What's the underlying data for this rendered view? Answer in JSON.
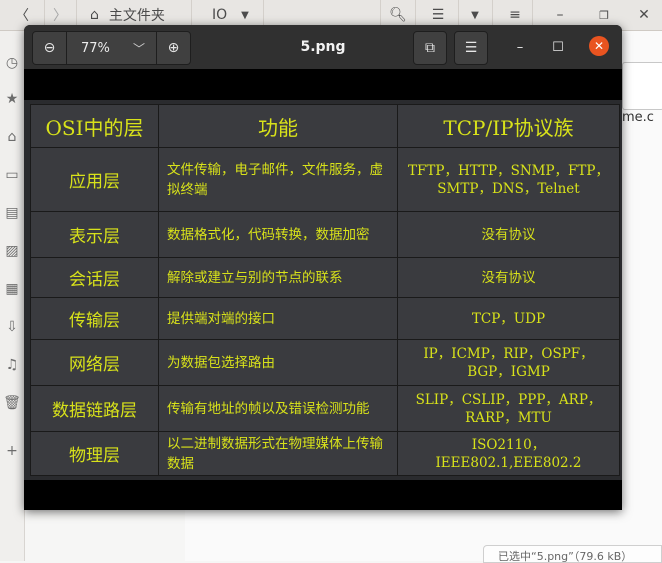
{
  "file_manager": {
    "path_home": "主文件夹",
    "path_folder": "IO",
    "bg_file_name": "me.c",
    "status_text": "已选中“5.png”（79.6 kB）"
  },
  "viewer": {
    "title": "5.png",
    "zoom_level": "77%"
  },
  "table": {
    "headers": [
      "OSI中的层",
      "功能",
      "TCP/IP协议族"
    ],
    "rows": [
      {
        "layer": "应用层",
        "function": "文件传输，电子邮件，文件服务，虚拟终端",
        "protocols": "TFTP，HTTP，SNMP，FTP，SMTP，DNS，Telnet"
      },
      {
        "layer": "表示层",
        "function": "数据格式化，代码转换，数据加密",
        "protocols": "没有协议"
      },
      {
        "layer": "会话层",
        "function": "解除或建立与别的节点的联系",
        "protocols": "没有协议"
      },
      {
        "layer": "传输层",
        "function": "提供端对端的接口",
        "protocols": "TCP，UDP"
      },
      {
        "layer": "网络层",
        "function": "为数据包选择路由",
        "protocols": "IP，ICMP，RIP，OSPF，BGP，IGMP"
      },
      {
        "layer": "数据链路层",
        "function": "传输有地址的帧以及错误检测功能",
        "protocols": "SLIP，CSLIP，PPP，ARP，RARP，MTU"
      },
      {
        "layer": "物理层",
        "function": "以二进制数据形式在物理媒体上传输数据",
        "protocols": "ISO2110，IEEE802.1,EEE802.2"
      }
    ]
  },
  "colors": {
    "accent_close": "#e95420",
    "table_text": "#d8e21a",
    "table_bg": "#3a3b3f"
  },
  "icons": [
    "back-icon",
    "forward-icon",
    "home-icon",
    "dropdown-icon",
    "search-icon",
    "list-view-icon",
    "menu-icon",
    "minimize-icon",
    "restore-icon",
    "close-icon",
    "zoom-out-icon",
    "zoom-in-icon",
    "fit-icon",
    "hamburger-icon"
  ]
}
